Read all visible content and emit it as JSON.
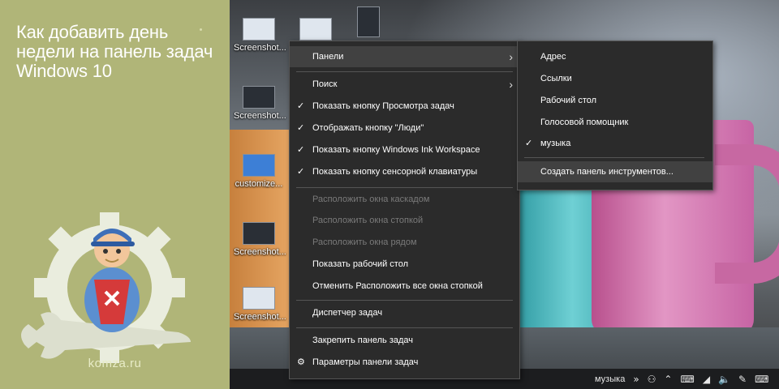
{
  "banner": {
    "title": "Как добавить день недели на панель задач Windows 10",
    "site": "komza.ru"
  },
  "desktop_icons": [
    {
      "label": "Screenshot..."
    },
    {
      "label": "Screenshot..."
    },
    {
      "label": "customize..."
    },
    {
      "label": "Screenshot..."
    },
    {
      "label": "Screenshot..."
    }
  ],
  "context_menu": {
    "items": [
      {
        "label": "Панели",
        "checked": false,
        "disabled": false,
        "has_submenu": true,
        "highlighted": true
      },
      {
        "label": "Поиск",
        "checked": false,
        "disabled": false,
        "has_submenu": true
      },
      {
        "label": "Показать кнопку Просмотра задач",
        "checked": true,
        "disabled": false
      },
      {
        "label": "Отображать кнопку \"Люди\"",
        "checked": true,
        "disabled": false
      },
      {
        "label": "Показать кнопку Windows Ink Workspace",
        "checked": true,
        "disabled": false
      },
      {
        "label": "Показать кнопку сенсорной клавиатуры",
        "checked": true,
        "disabled": false
      },
      {
        "label": "Расположить окна каскадом",
        "checked": false,
        "disabled": true
      },
      {
        "label": "Расположить окна стопкой",
        "checked": false,
        "disabled": true
      },
      {
        "label": "Расположить окна рядом",
        "checked": false,
        "disabled": true
      },
      {
        "label": "Показать рабочий стол",
        "checked": false,
        "disabled": false
      },
      {
        "label": "Отменить Расположить все окна стопкой",
        "checked": false,
        "disabled": false
      },
      {
        "label": "Диспетчер задач",
        "checked": false,
        "disabled": false
      },
      {
        "label": "Закрепить панель задач",
        "checked": false,
        "disabled": false
      },
      {
        "label": "Параметры панели задач",
        "checked": false,
        "disabled": false,
        "icon": "gear-icon"
      }
    ]
  },
  "submenu": {
    "items": [
      {
        "label": "Адрес",
        "checked": false
      },
      {
        "label": "Ссылки",
        "checked": false
      },
      {
        "label": "Рабочий стол",
        "checked": false
      },
      {
        "label": "Голосовой помощник",
        "checked": false
      },
      {
        "label": "музыка",
        "checked": true
      },
      {
        "label": "Создать панель инструментов...",
        "checked": false,
        "highlighted": true
      }
    ]
  },
  "taskbar": {
    "toolbar_label": "музыка",
    "icons": [
      "people-icon",
      "chevron-up-icon",
      "keyboard-icon",
      "network-icon",
      "volume-icon",
      "pen-icon",
      "keyboard-icon"
    ]
  },
  "colors": {
    "banner_bg": "#b0b578",
    "menu_bg": "#2b2b2b",
    "menu_highlight": "#414141",
    "menu_disabled_text": "#7a7a7a",
    "taskbar_bg": "#1c1d1f"
  }
}
